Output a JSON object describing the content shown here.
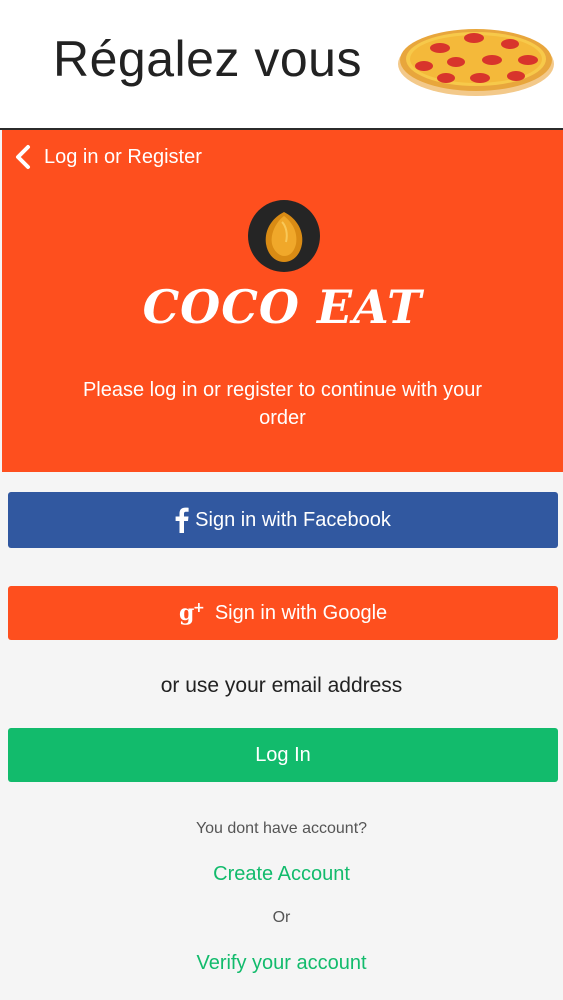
{
  "colors": {
    "accent": "#fe4f1e",
    "facebook": "#3158a0",
    "green": "#12bb6c"
  },
  "promo": {
    "title": "Régalez vous",
    "icon": "pizza-icon"
  },
  "header": {
    "back_label": "Log in or Register",
    "back_icon": "chevron-left-icon",
    "logo_icon": "coconut-icon",
    "brand": "COCO EAT",
    "subtitle": "Please log in or register to continue with your order"
  },
  "buttons": {
    "facebook_label": "Sign in with Facebook",
    "facebook_icon": "facebook-icon",
    "google_label": "Sign in with Google",
    "google_icon": "google-plus-icon",
    "login_label": "Log In"
  },
  "body": {
    "or_email": "or use your email address",
    "no_account": "You dont have account?",
    "create_account": "Create Account",
    "or": "Or",
    "verify_account": "Verify your account"
  }
}
